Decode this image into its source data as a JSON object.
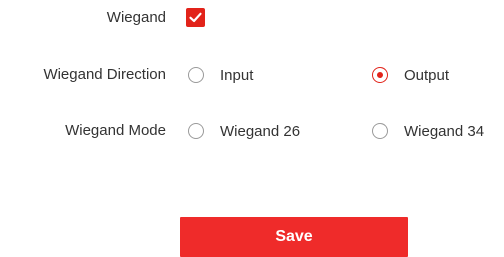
{
  "wiegand": {
    "label": "Wiegand",
    "checked": true
  },
  "direction": {
    "label": "Wiegand Direction",
    "options": [
      {
        "label": "Input",
        "selected": false
      },
      {
        "label": "Output",
        "selected": true
      }
    ]
  },
  "mode": {
    "label": "Wiegand Mode",
    "options": [
      {
        "label": "Wiegand 26",
        "selected": false
      },
      {
        "label": "Wiegand 34",
        "selected": false
      }
    ]
  },
  "actions": {
    "save_label": "Save"
  },
  "colors": {
    "accent": "#e2231a",
    "save_button": "#ef2b2a"
  }
}
